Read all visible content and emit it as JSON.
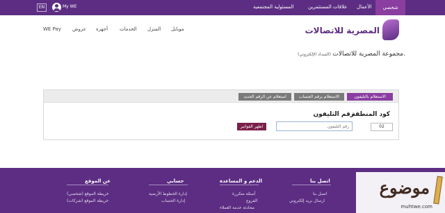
{
  "topbar": {
    "lang": "EN",
    "my_we": "My WE",
    "links": [
      "المسئولية المجتمعية",
      "علاقات المستثمرين",
      "الأعمال"
    ],
    "active": "شخصي"
  },
  "logo": {
    "text": "المصرية للاتصالات"
  },
  "nav": [
    "موبايل",
    "المنزل",
    "الخدمات",
    "أجهزة",
    "عروض",
    "WE Pay"
  ],
  "page": {
    "title": "مجموعة المصرية للاتصالات.",
    "subtitle": "(السداد الإلكتروني)"
  },
  "panel": {
    "tabs": [
      "الاستعلام بالتليفون",
      "الاستعلام برقم الحساب",
      "استعلام عن الرقم الجديد"
    ],
    "area_label": "كود المنطقة",
    "phone_label": "رقم التليفون",
    "area_value": "02",
    "phone_placeholder": "رقم التليفون",
    "show_button": "اظهر الفواتير"
  },
  "footer": {
    "columns": [
      {
        "title": "عن الموقع",
        "links": [
          "خريطة الموقع (شخصي)",
          "خريطة الموقع (شركات)"
        ]
      },
      {
        "title": "حسابي",
        "links": [
          "إدارة الخطوط الأرضية",
          "إدارة الحساب"
        ]
      },
      {
        "title": "الدعم و المساعدة",
        "links": [
          "أسئلة متكررة",
          "الفروع",
          "محادثة خدمة العملاء"
        ]
      },
      {
        "title": "اتصل بنا",
        "links": [
          "اتصل بنا",
          "ارسال بريد إلكتروني"
        ]
      }
    ]
  },
  "watermark": {
    "text": "موضوع",
    "url": "muhtwe.com"
  },
  "colors": {
    "brand": "#5c2d82",
    "accent": "#8a3ea0",
    "button": "#7a1f4a"
  }
}
